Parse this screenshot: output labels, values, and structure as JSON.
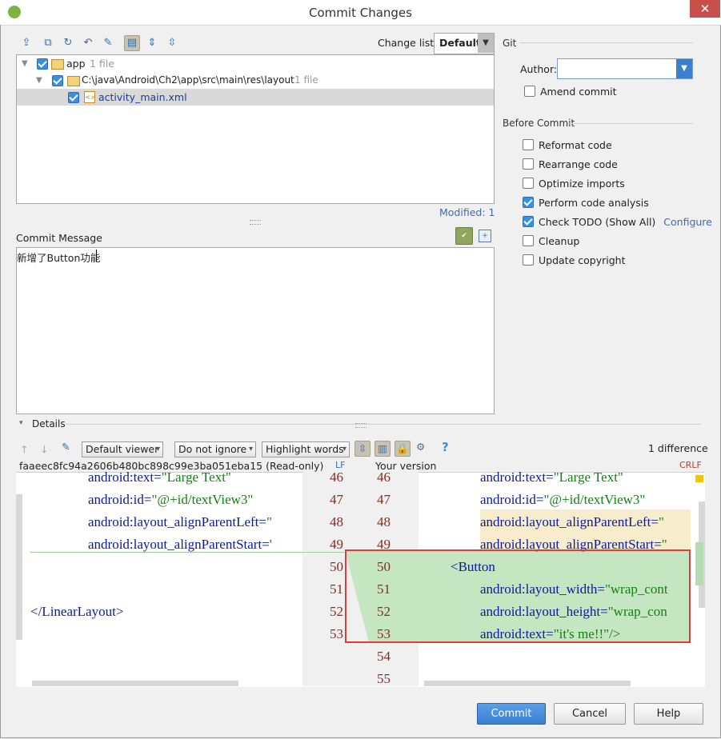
{
  "window": {
    "title": "Commit Changes",
    "close_glyph": "✕"
  },
  "toolbar": {
    "icons": [
      "move-to-changelist-icon",
      "show-diff-icon",
      "refresh-icon",
      "rollback-icon",
      "edit-source-icon",
      "group-by-directory-icon",
      "expand-all-icon",
      "collapse-all-icon"
    ],
    "change_list_label": "Change list:",
    "change_list_value": "Default"
  },
  "tree": {
    "app": {
      "name": "app",
      "count": "1 file"
    },
    "dir": {
      "path": "C:\\java\\Android\\Ch2\\app\\src\\main\\res\\layout",
      "count": "1 file"
    },
    "file": {
      "name": "activity_main.xml"
    }
  },
  "modified": "Modified: 1",
  "commit_message": {
    "label": "Commit Message",
    "text": "新增了Button功能"
  },
  "git": {
    "section": "Git",
    "author_label": "Author:",
    "author_value": "",
    "amend_label": "Amend commit",
    "amend_checked": false
  },
  "before_commit": {
    "section": "Before Commit",
    "options": [
      {
        "label": "Reformat code",
        "checked": false
      },
      {
        "label": "Rearrange code",
        "checked": false
      },
      {
        "label": "Optimize imports",
        "checked": false
      },
      {
        "label": "Perform code analysis",
        "checked": true
      },
      {
        "label": "Check TODO (Show All)",
        "checked": true,
        "link": "Configure"
      },
      {
        "label": "Cleanup",
        "checked": false
      },
      {
        "label": "Update copyright",
        "checked": false
      }
    ]
  },
  "details": {
    "label": "Details",
    "viewer": "Default viewer",
    "ignore": "Do not ignore",
    "highlight": "Highlight words",
    "difference_count": "1 difference",
    "left_header": "faaeec8fc94a2606b480bc898c99e3ba051eba15 (Read-only)",
    "left_eol": "LF",
    "right_header": "Your version",
    "right_eol": "CRLF"
  },
  "diff": {
    "left_lines": [
      {
        "attr": "android:text=",
        "val": "\"Large Text\""
      },
      {
        "attr": "android:id=",
        "val": "\"@+id/textView3\""
      },
      {
        "attr": "android:layout_alignParentLeft=",
        "val": "\""
      },
      {
        "attr": "android:layout_alignParentStart=",
        "val": "'"
      },
      {
        "attr": "",
        "val": ""
      },
      {
        "attr": "",
        "val": ""
      },
      {
        "attr": "</LinearLayout>",
        "val": ""
      }
    ],
    "left_numbers": [
      "46",
      "47",
      "48",
      "49",
      "50",
      "51",
      "52",
      "53"
    ],
    "right_numbers": [
      "46",
      "47",
      "48",
      "49",
      "50",
      "51",
      "52",
      "53",
      "54",
      "55"
    ],
    "right_lines": [
      {
        "attr": "android:text=",
        "val": "\"Large Text\""
      },
      {
        "attr": "android:id=",
        "val": "\"@+id/textView3\""
      },
      {
        "attr": "android:layout_alignParentLeft=",
        "val": "\""
      },
      {
        "attr": "android:layout_alignParentStart=",
        "val": "\""
      },
      {
        "attr": "<Button",
        "val": ""
      },
      {
        "attr": "android:layout_width=",
        "val": "\"wrap_cont"
      },
      {
        "attr": "android:layout_height=",
        "val": "\"wrap_con"
      },
      {
        "attr": "android:text=",
        "val": "\"it's me!!\"/>"
      }
    ]
  },
  "buttons": {
    "commit": "Commit",
    "cancel": "Cancel",
    "help": "Help"
  }
}
